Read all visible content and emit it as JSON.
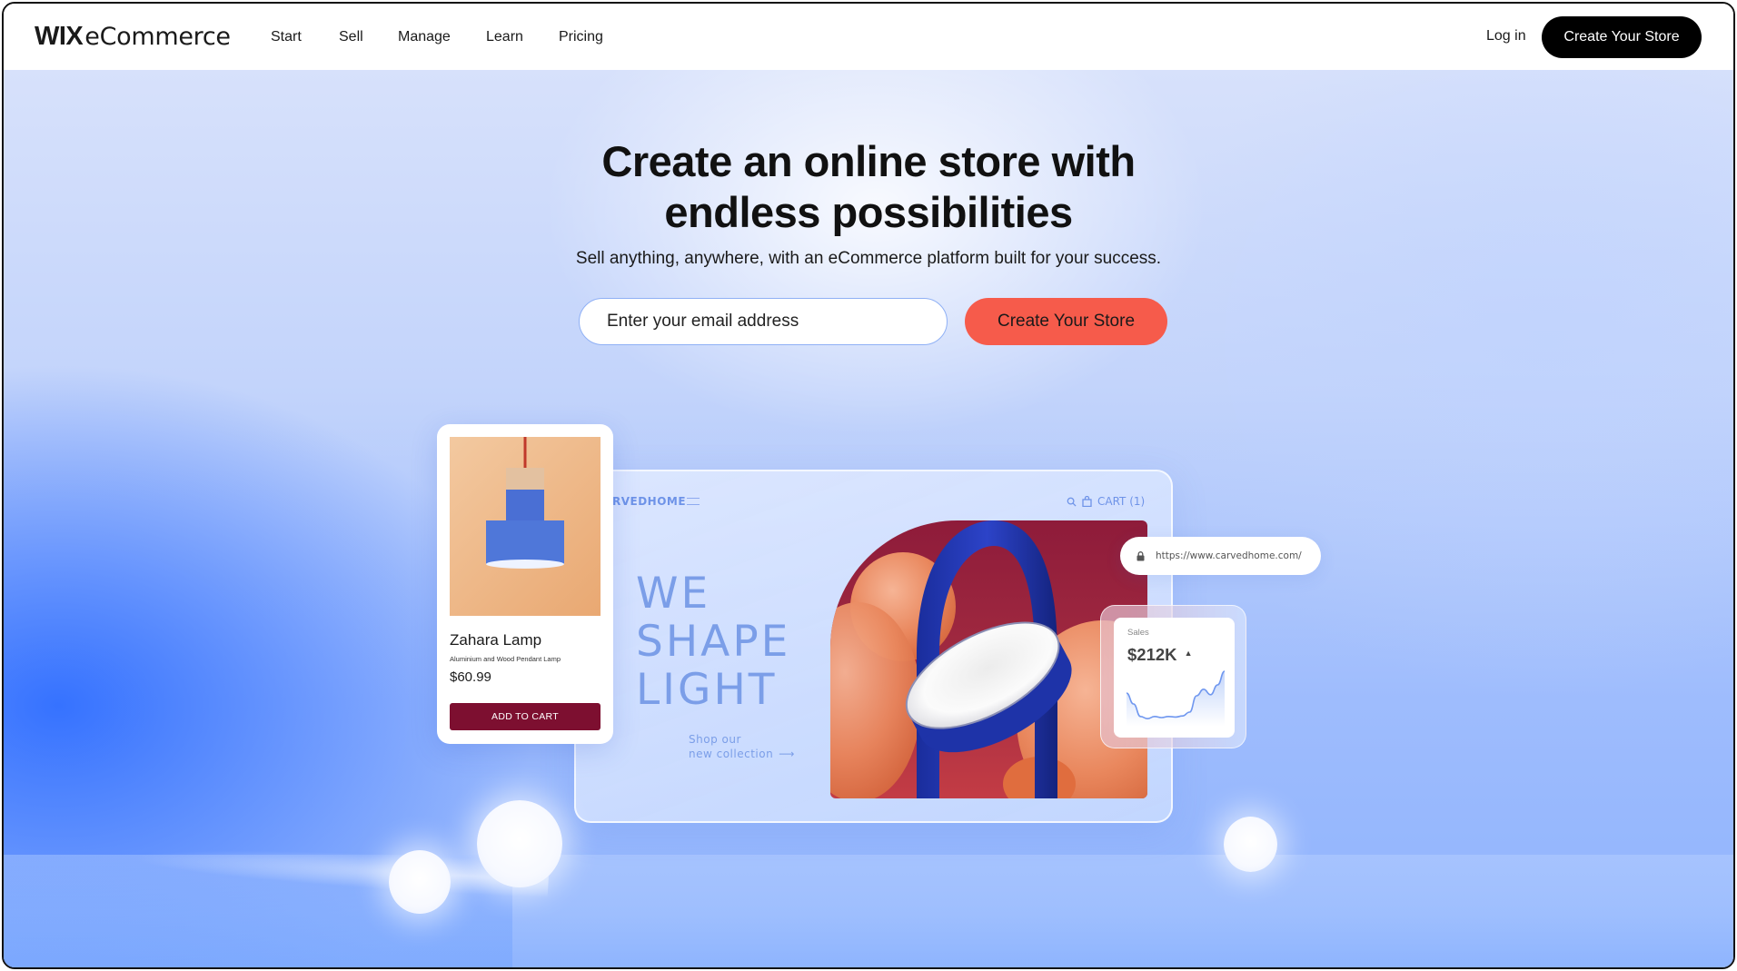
{
  "header": {
    "logo_brand": "WIX",
    "logo_product": "eCommerce",
    "nav": [
      {
        "label": "Start"
      },
      {
        "label": "Sell"
      },
      {
        "label": "Manage"
      },
      {
        "label": "Learn"
      },
      {
        "label": "Pricing"
      }
    ],
    "login_label": "Log in",
    "cta_label": "Create Your Store"
  },
  "hero": {
    "title_line1": "Create an online store with",
    "title_line2": "endless possibilities",
    "subtitle": "Sell anything, anywhere, with an eCommerce platform built for your success.",
    "email_placeholder": "Enter your email address",
    "email_value": "",
    "cta_label": "Create Your Store",
    "cta_color": "#f65b4b"
  },
  "store_mock": {
    "brand": "RVEDHOME",
    "cart_label": "CART (1)",
    "headline_lines": [
      "WE",
      "SHAPE",
      "LIGHT"
    ],
    "cta_line1": "Shop our",
    "cta_line2": "new collection",
    "cta_arrow": "⟶"
  },
  "product_card": {
    "name": "Zahara Lamp",
    "description": "Aluminium and Wood Pendant Lamp",
    "price": "$60.99",
    "add_to_cart_label": "ADD TO CART",
    "button_color": "#7d0f30"
  },
  "url_pill": {
    "url": "https://www.carvedhome.com/"
  },
  "sales_card": {
    "label": "Sales",
    "value": "$212K",
    "trend": "▲",
    "sparkline": [
      0.55,
      0.35,
      0.12,
      0.08,
      0.12,
      0.1,
      0.12,
      0.11,
      0.13,
      0.2,
      0.5,
      0.62,
      0.52,
      0.7,
      0.95
    ]
  }
}
